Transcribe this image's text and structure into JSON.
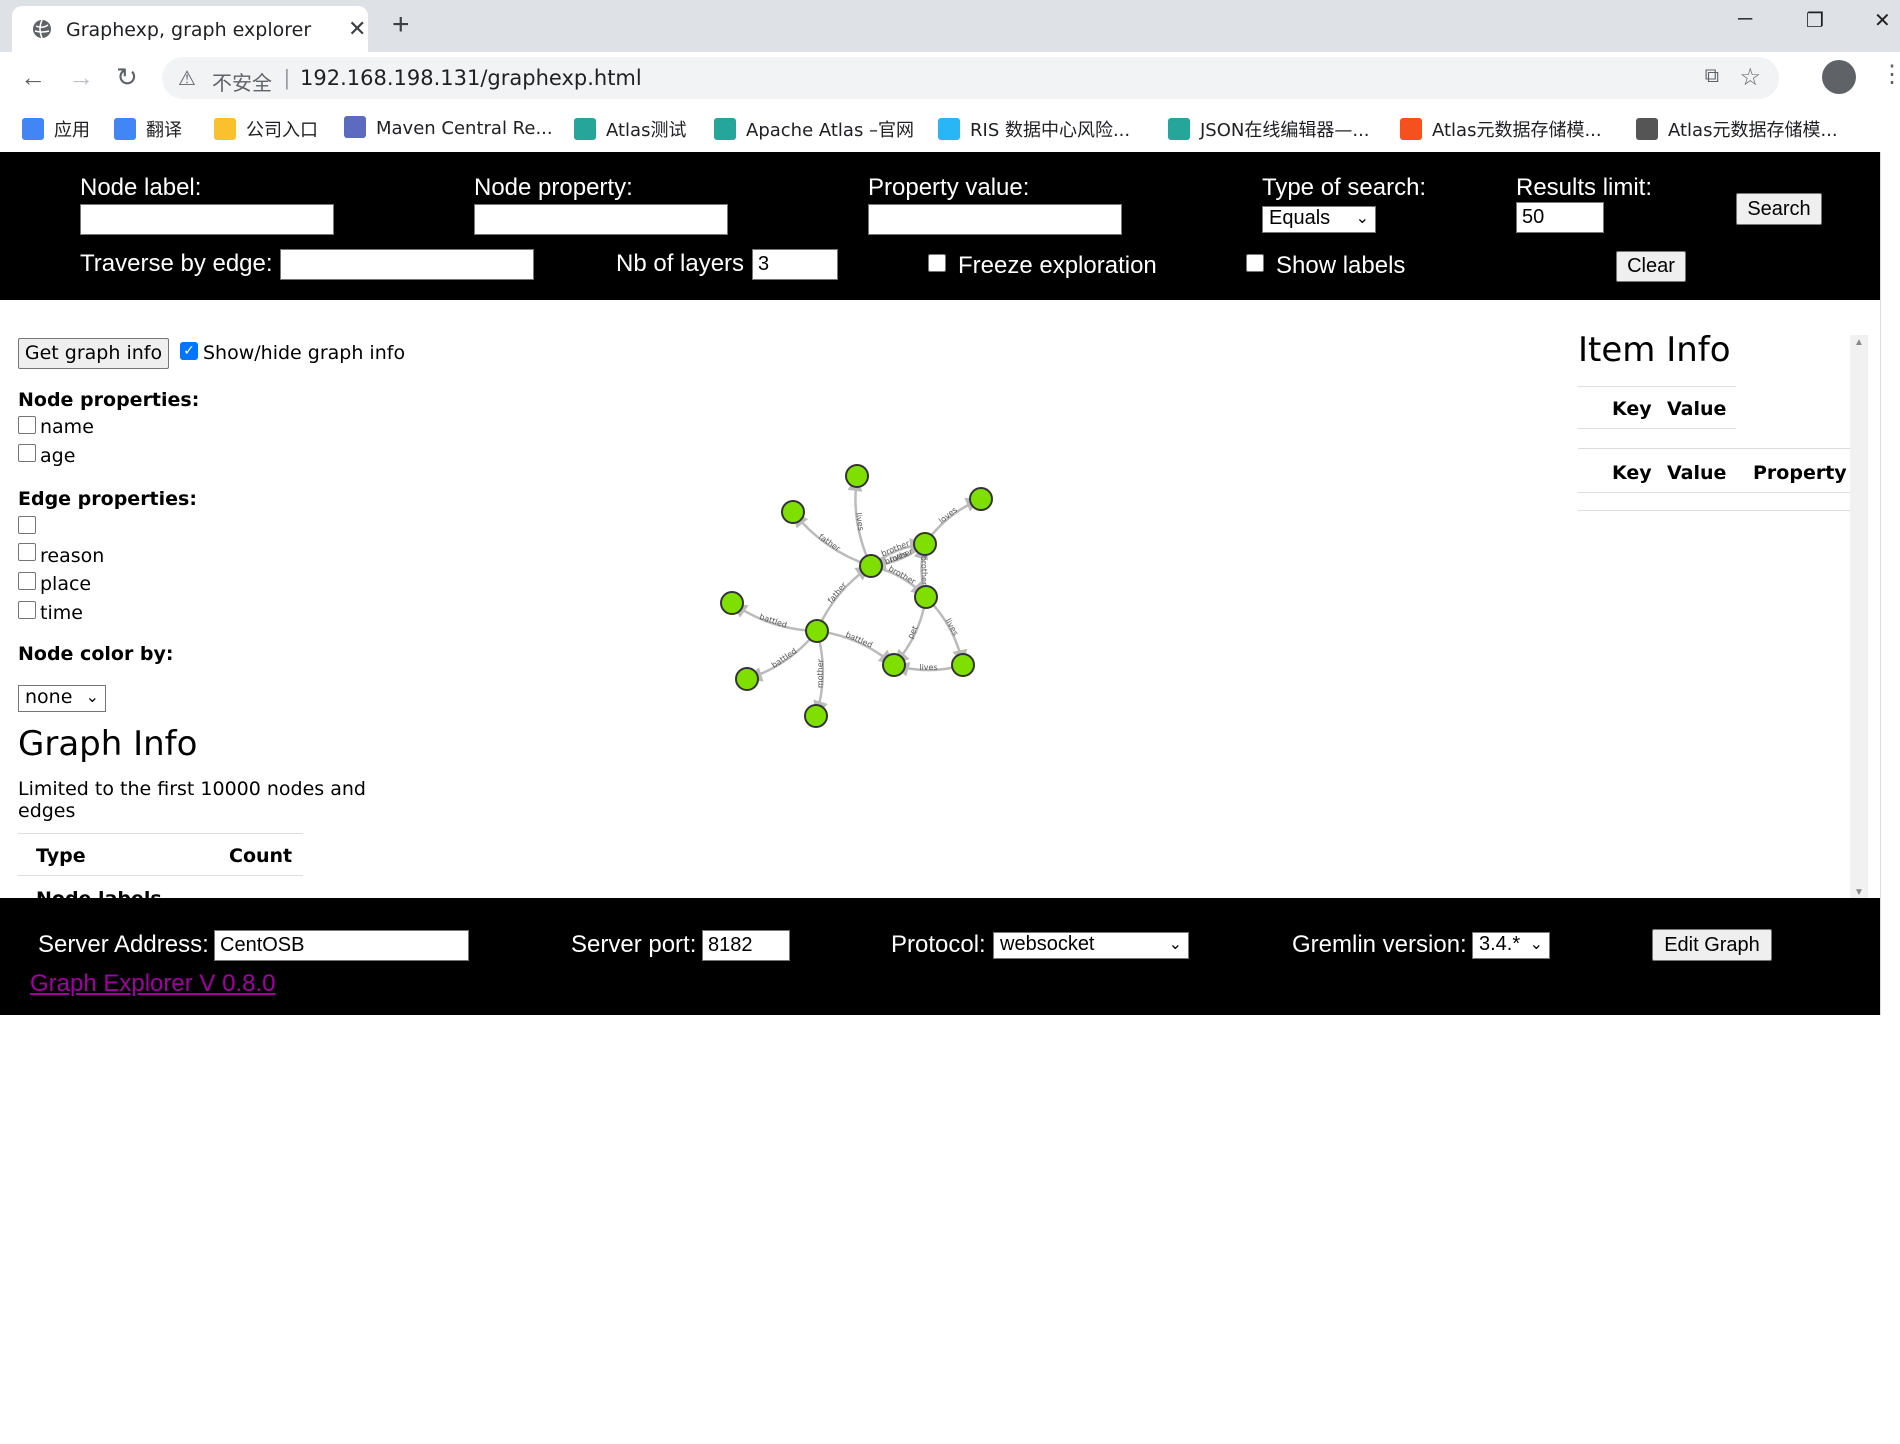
{
  "browser": {
    "tab_title": "Graphexp, graph explorer",
    "tab_close": "✕",
    "new_tab": "+",
    "insecure_label": "不安全",
    "url": "192.168.198.131/graphexp.html",
    "bookmarks": [
      {
        "label": "应用",
        "color": "#4285f4"
      },
      {
        "label": "翻译",
        "color": "#4285f4"
      },
      {
        "label": "公司入口",
        "color": "#fbc02d"
      },
      {
        "label": "Maven Central Re...",
        "color": "#5c6bc0"
      },
      {
        "label": "Atlas测试",
        "color": "#26a69a"
      },
      {
        "label": "Apache Atlas –官网",
        "color": "#26a69a"
      },
      {
        "label": "RIS 数据中心风险...",
        "color": "#29b6f6"
      },
      {
        "label": "JSON在线编辑器—...",
        "color": "#26a69a"
      },
      {
        "label": "Atlas元数据存储模...",
        "color": "#f4511e"
      },
      {
        "label": "Atlas元数据存储模...",
        "color": "#555555"
      }
    ]
  },
  "search": {
    "node_label": "Node label:",
    "node_property": "Node property:",
    "property_value": "Property value:",
    "type_of_search": "Type of search:",
    "type_of_search_value": "Equals",
    "results_limit": "Results limit:",
    "results_limit_value": "50",
    "search_button": "Search",
    "traverse_by_edge": "Traverse by edge:",
    "nb_of_layers": "Nb of layers",
    "nb_of_layers_value": "3",
    "freeze_exploration": "Freeze exploration",
    "show_labels": "Show labels",
    "clear_button": "Clear"
  },
  "graph_info_panel": {
    "get_graph_info_button": "Get graph info",
    "show_hide_label": "Show/hide graph info",
    "node_properties_title": "Node properties:",
    "node_properties": [
      "name",
      "age"
    ],
    "edge_properties_title": "Edge properties:",
    "edge_properties": [
      "",
      "reason",
      "place",
      "time"
    ],
    "node_color_by_title": "Node color by:",
    "node_color_by_value": "none",
    "graph_info_heading": "Graph Info",
    "graph_info_note": "Limited to the first 10000 nodes and edges",
    "table_headers": [
      "Type",
      "Count"
    ],
    "table_first_row": "Node labels"
  },
  "item_info": {
    "heading": "Item Info",
    "table1_headers": [
      "Key",
      "Value"
    ],
    "table2_headers": [
      "Key",
      "Value",
      "Property"
    ]
  },
  "server": {
    "server_address_label": "Server Address:",
    "server_address_value": "CentOSB",
    "server_port_label": "Server port:",
    "server_port_value": "8182",
    "protocol_label": "Protocol:",
    "protocol_value": "websocket",
    "gremlin_version_label": "Gremlin version:",
    "gremlin_version_value": "3.4.*",
    "edit_graph_button": "Edit Graph",
    "footer_link": "Graph Explorer V 0.8.0"
  },
  "graph": {
    "node_color": "#7fe000",
    "edge_labels": [
      "father",
      "lives",
      "brother",
      "brother",
      "brother",
      "brother",
      "father",
      "battled",
      "battled",
      "battled",
      "mother",
      "pet",
      "lives",
      "lives",
      "lives",
      "loves"
    ]
  }
}
